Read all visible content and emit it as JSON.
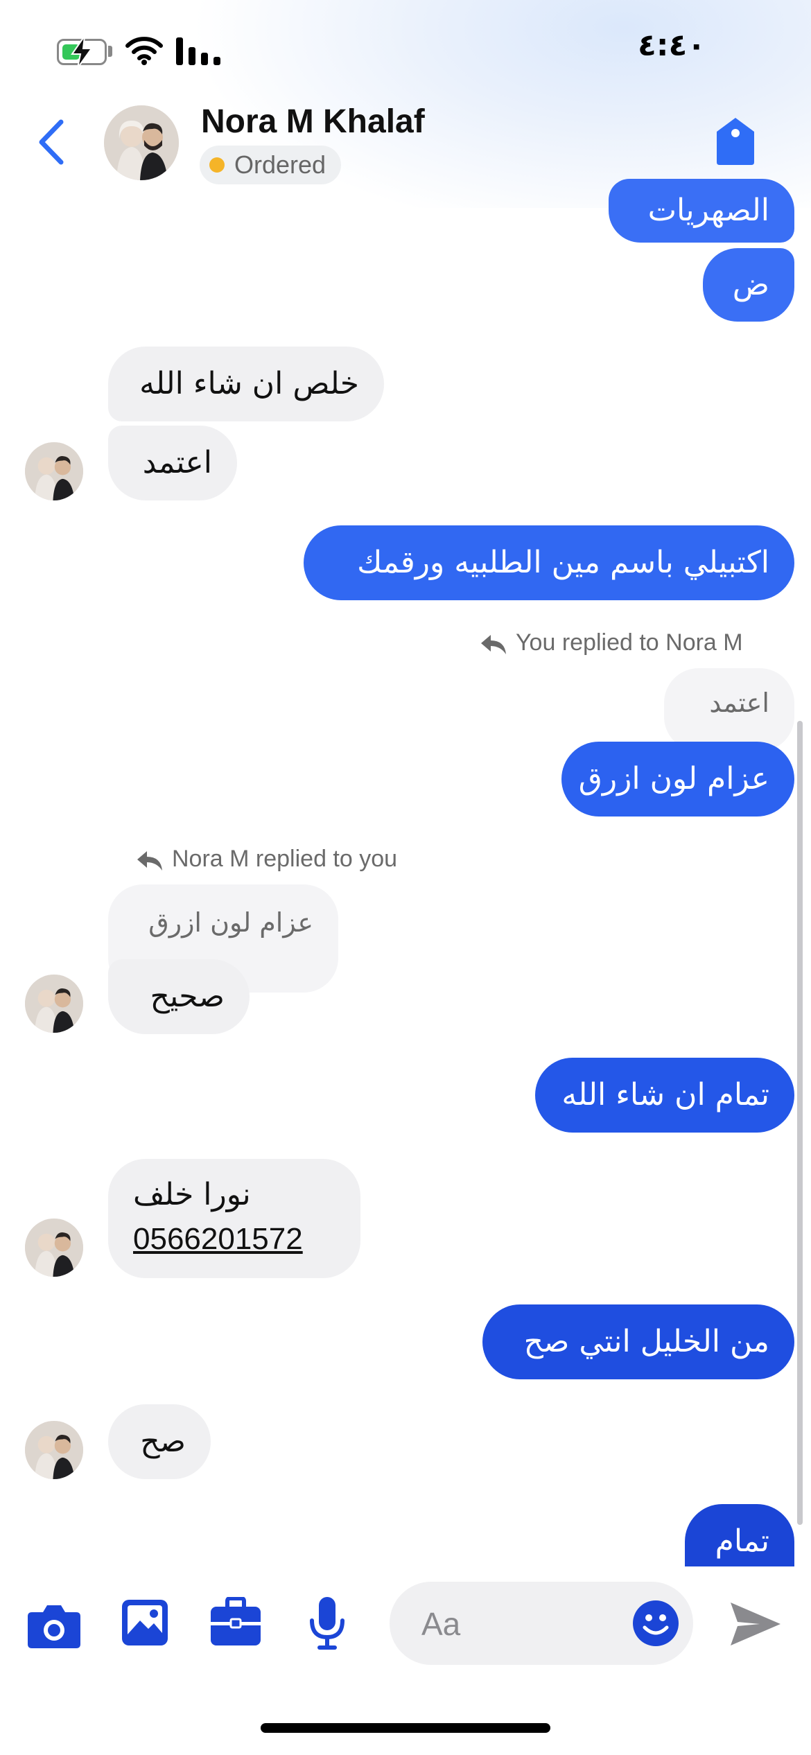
{
  "status_bar": {
    "time": "٤:٤٠",
    "battery_level": 0.45
  },
  "header": {
    "contact_name": "Nora M Khalaf",
    "status_label": "Ordered"
  },
  "colors": {
    "accent": "#2f6df6",
    "status_dot": "#f5b428",
    "incoming_bubble": "#f0f0f2"
  },
  "messages": [
    {
      "from": "me",
      "text": "الصهريات",
      "color": "#3a6ff5"
    },
    {
      "from": "me",
      "text": "ض",
      "color": "#3a6ff5"
    },
    {
      "from": "them",
      "text": "خلص ان شاء الله"
    },
    {
      "from": "them",
      "text": "اعتمد"
    },
    {
      "from": "me",
      "text": "اكتبيلي باسم مين الطلبيه ورقمك",
      "color": "#3168f2"
    },
    {
      "from": "me",
      "reply_note": "You replied to Nora M",
      "quoted": "اعتمد",
      "text": "عزام لون ازرق",
      "color": "#2c62f0"
    },
    {
      "from": "them",
      "reply_note": "Nora M replied to you",
      "quoted": "عزام لون ازرق",
      "text": "صحيح"
    },
    {
      "from": "me",
      "text": "تمام ان شاء الله",
      "color": "#2457e8"
    },
    {
      "from": "them",
      "text_line1": "نورا خلف",
      "text_line2": "0566201572"
    },
    {
      "from": "me",
      "text": "من الخليل انتي صح",
      "color": "#1f4ee0"
    },
    {
      "from": "them",
      "text": "صح"
    },
    {
      "from": "me",
      "text": "تمام",
      "color": "#1b45d6"
    }
  ],
  "composer": {
    "placeholder": "Aa"
  }
}
